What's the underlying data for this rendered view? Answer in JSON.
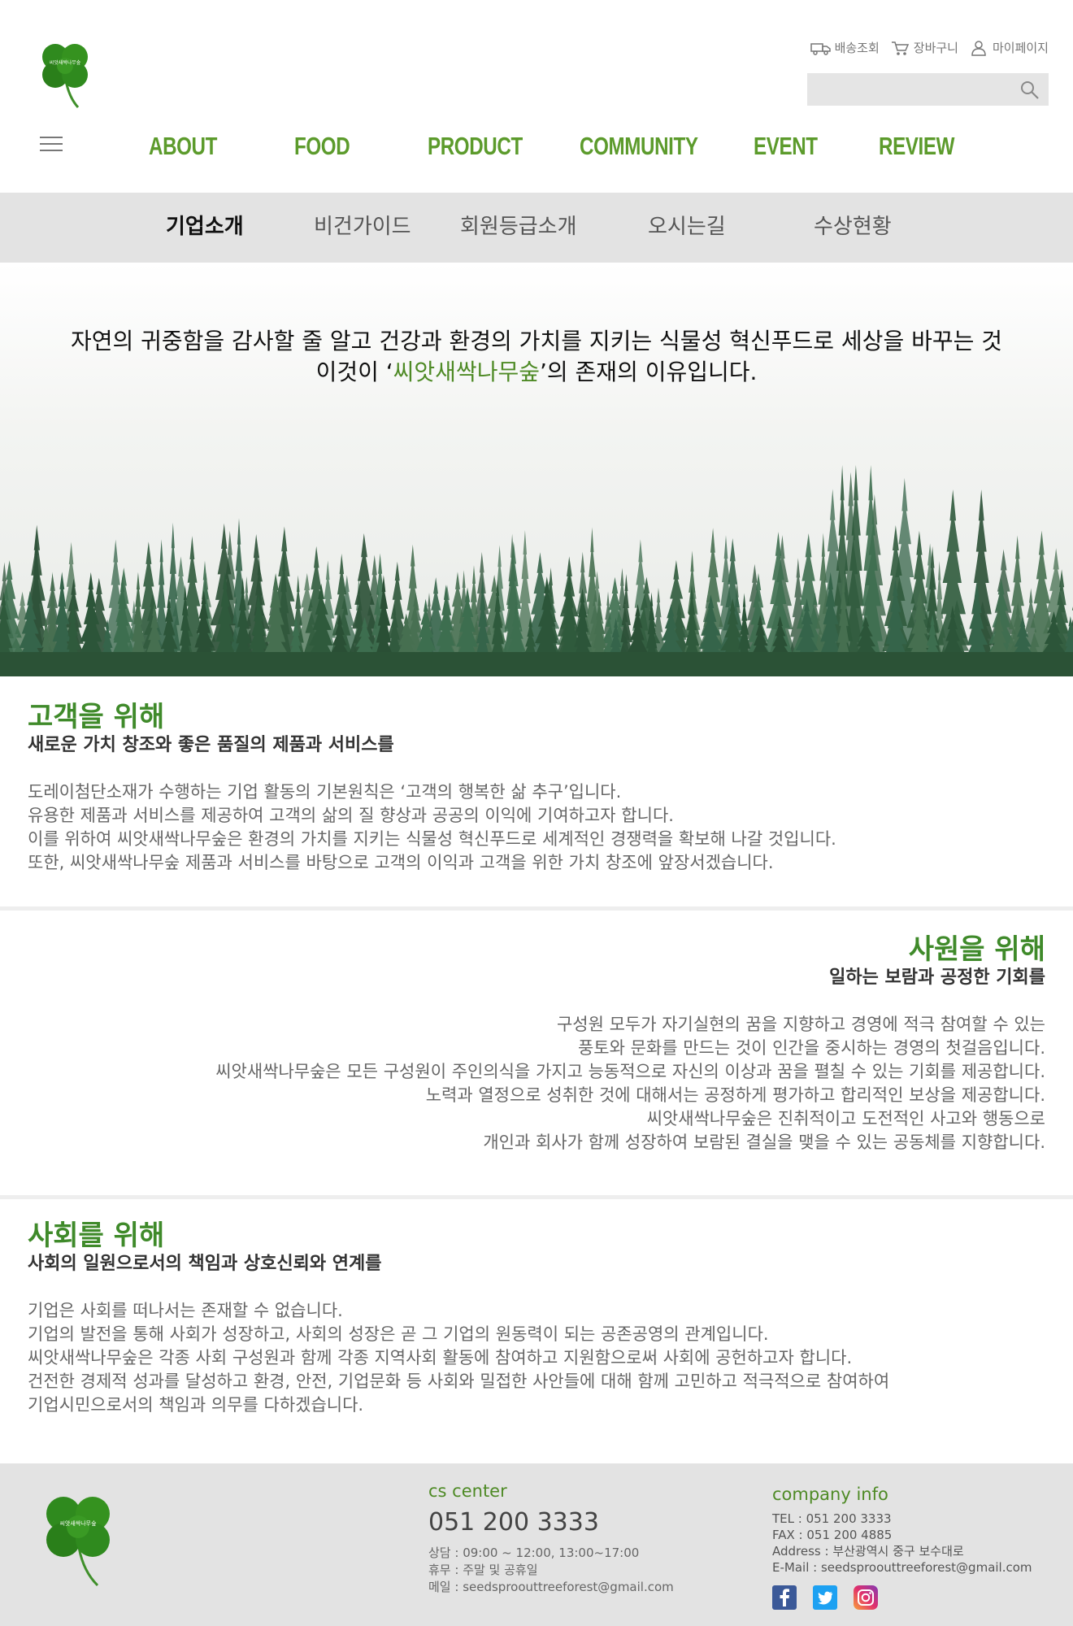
{
  "header": {
    "logo_text": "씨앗새싹나무숲",
    "utils": [
      {
        "label": "배송조회",
        "icon": "truck-icon"
      },
      {
        "label": "장바구니",
        "icon": "cart-icon"
      },
      {
        "label": "마이페이지",
        "icon": "user-icon"
      }
    ],
    "search": {
      "placeholder": "",
      "icon": "search-icon"
    },
    "gnb": [
      "ABOUT",
      "FOOD",
      "PRODUCT",
      "COMMUNITY",
      "EVENT",
      "REVIEW"
    ]
  },
  "subnav": {
    "items": [
      "기업소개",
      "비건가이드",
      "회원등급소개",
      "오시는길",
      "수상현황"
    ],
    "active": "기업소개"
  },
  "hero": {
    "line1": "자연의 귀중함을 감사할 줄 알고 건강과 환경의 가치를 지키는 식물성 혁신푸드로 세상을 바꾸는 것",
    "line2_prefix": "이것이 ‘",
    "line2_brand": "씨앗새싹나무숲",
    "line2_suffix": "’의 존재의 이유입니다."
  },
  "sections": [
    {
      "title": "고객을 위해",
      "subtitle": "새로운 가치 창조와 좋은 품질의 제품과 서비스를",
      "body": [
        "도레이첨단소재가 수행하는 기업 활동의 기본원칙은 ‘고객의 행복한 삶 추구’입니다.",
        "유용한 제품과 서비스를 제공하여 고객의 삶의 질 향상과 공공의 이익에 기여하고자 합니다.",
        "이를 위하여 씨앗새싹나무숲은 환경의 가치를 지키는 식물성 혁신푸드로 세계적인 경쟁력을 확보해 나갈 것입니다.",
        "또한, 씨앗새싹나무숲 제품과 서비스를 바탕으로 고객의 이익과 고객을 위한 가치 창조에 앞장서겠습니다."
      ]
    },
    {
      "title": "사원을 위해",
      "subtitle": "일하는 보람과 공정한 기회를",
      "body": [
        "구성원 모두가 자기실현의 꿈을 지향하고 경영에 적극 참여할 수 있는",
        "풍토와 문화를 만드는 것이 인간을 중시하는 경영의 첫걸음입니다.",
        "씨앗새싹나무숲은 모든 구성원이 주인의식을 가지고 능동적으로 자신의 이상과 꿈을 펼칠 수 있는 기회를 제공합니다.",
        "노력과 열정으로 성취한 것에 대해서는 공정하게 평가하고 합리적인 보상을 제공합니다.",
        "씨앗새싹나무숲은 진취적이고 도전적인 사고와 행동으로",
        "개인과 회사가 함께 성장하여 보람된 결실을 맺을 수 있는 공동체를 지향합니다."
      ]
    },
    {
      "title": "사회를 위해",
      "subtitle": "사회의 일원으로서의 책임과 상호신뢰와 연계를",
      "body": [
        "기업은 사회를 떠나서는 존재할 수 없습니다.",
        "기업의 발전을 통해 사회가 성장하고, 사회의 성장은 곧 그 기업의 원동력이 되는 공존공영의 관계입니다.",
        "씨앗새싹나무숲은 각종 사회 구성원과 함께 각종 지역사회 활동에 참여하고 지원함으로써 사회에 공헌하고자 합니다.",
        "건전한 경제적 성과를 달성하고 환경, 안전, 기업문화 등 사회와 밀접한 사안들에 대해 함께 고민하고 적극적으로 참여하여",
        "기업시민으로서의 책임과 의무를 다하겠습니다."
      ]
    }
  ],
  "footer": {
    "cs": {
      "label": "cs center",
      "tel": "051 200 3333",
      "hours": "상담 : 09:00 ~ 12:00, 13:00~17:00",
      "holiday": "휴무 : 주말 및 공휴일",
      "mail": "메일 : seedsproouttreeforest@gmail.com"
    },
    "company": {
      "label": "company info",
      "tel": "TEL : 051 200 3333",
      "fax": "FAX : 051 200 4885",
      "address": "Address : 부산광역시 중구 보수대로",
      "email": "E-Mail : seedsproouttreeforest@gmail.com"
    },
    "sns": [
      "facebook-icon",
      "twitter-icon",
      "instagram-icon"
    ]
  },
  "colors": {
    "brand_green": "#5c9b2c",
    "title_green": "#3f8a2a",
    "subnav_bg": "#e3e3e3",
    "footer_bg": "#e3e3e3"
  }
}
